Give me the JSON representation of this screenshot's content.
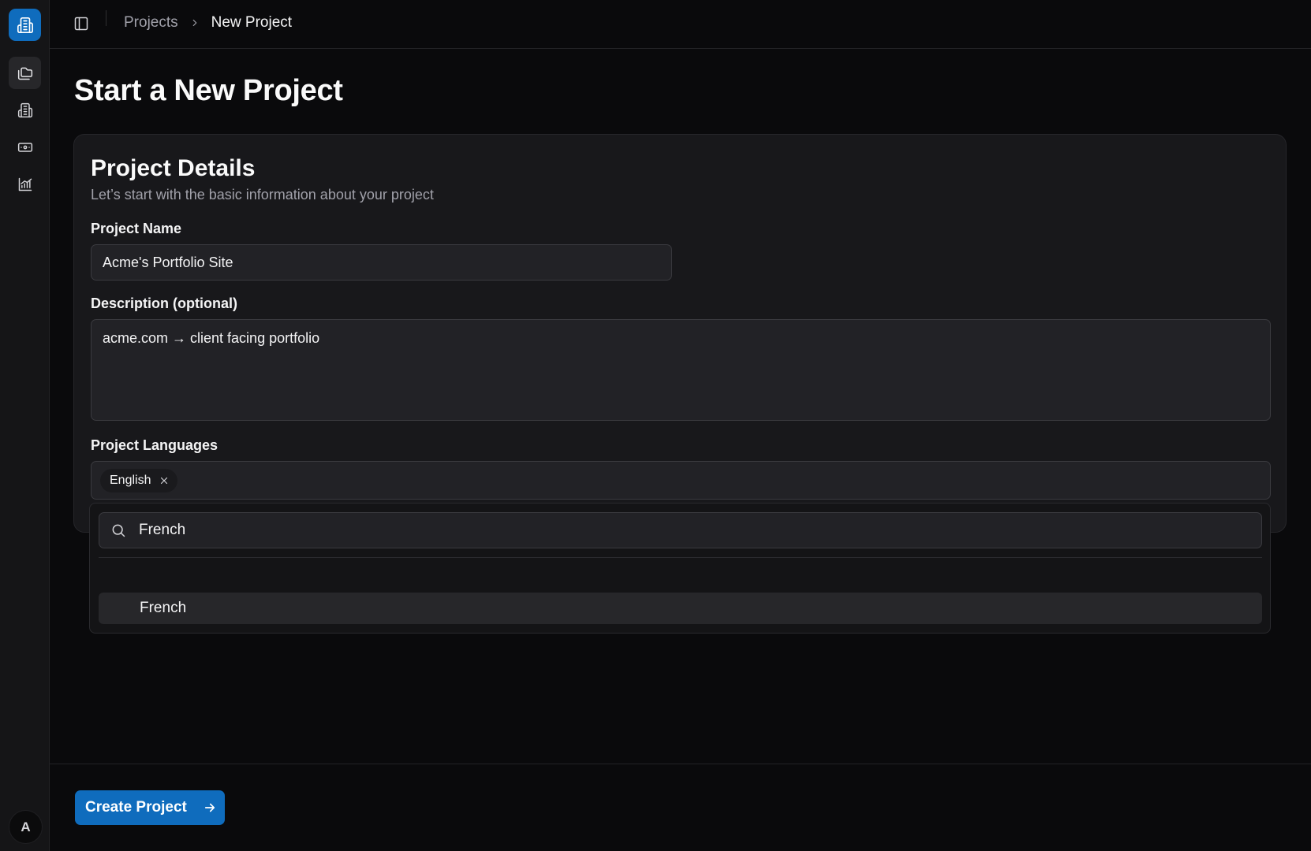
{
  "colors": {
    "accent": "#0f6cbd",
    "background": "#0a0a0c",
    "card": "#18181b",
    "input": "#222226"
  },
  "sidebar": {
    "logo_icon": "building-icon",
    "items": [
      {
        "icon": "folders-icon",
        "active": true
      },
      {
        "icon": "building-icon",
        "active": false
      },
      {
        "icon": "banknote-icon",
        "active": false
      },
      {
        "icon": "chart-icon",
        "active": false
      }
    ],
    "avatar_initial": "A"
  },
  "header": {
    "toggle_icon": "sidebar-toggle-icon",
    "breadcrumb": {
      "parent": "Projects",
      "separator_icon": "chevron-right-icon",
      "current": "New Project"
    }
  },
  "page": {
    "title": "Start a New Project"
  },
  "card": {
    "title": "Project Details",
    "subtitle": "Let’s start with the basic information about your project",
    "name_label": "Project Name",
    "name_value": "Acme's Portfolio Site",
    "description_label": "Description (optional)",
    "description_value": "acme.com → client facing portfolio",
    "languages_label": "Project Languages",
    "languages_selected": [
      "English"
    ]
  },
  "language_dropdown": {
    "search_value": "French",
    "options": [
      "French"
    ]
  },
  "footer": {
    "create_label": "Create Project"
  }
}
